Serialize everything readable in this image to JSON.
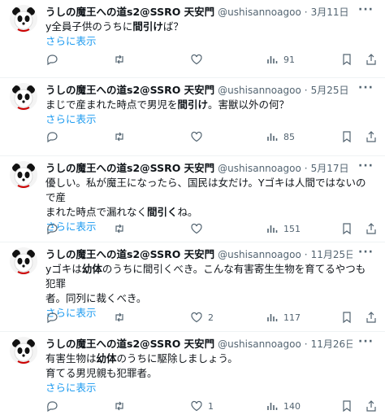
{
  "tweets": [
    {
      "user_name": "うしの魔王への道s2@SSRO 天安門",
      "handle": "@ushisannoagoo",
      "dot": "·",
      "date": "3月11日",
      "line1_pre": "y全員子供のうちに",
      "line1_bold": "間引け",
      "line1_post": "ば？",
      "show_more": "さらに表示",
      "replies": "",
      "retweets": "",
      "likes": "",
      "views": "91"
    },
    {
      "user_name": "うしの魔王への道s2@SSRO 天安門",
      "handle": "@ushisannoagoo",
      "dot": "·",
      "date": "5月25日",
      "line1_pre": "まじで産まれた時点で男児を",
      "line1_bold": "間引け",
      "line1_post": "。害獣以外の何？",
      "show_more": "さらに表示",
      "replies": "",
      "retweets": "",
      "likes": "",
      "views": "85"
    },
    {
      "user_name": "うしの魔王への道s2@SSRO 天安門",
      "handle": "@ushisannoagoo",
      "dot": "·",
      "date": "5月17日",
      "line1": "優しい。私が魔王になったら、国民は女だけ。Yゴキは人間ではないので産",
      "line2_pre": "まれた時点で漏れなく",
      "line2_bold": "間引く",
      "line2_post": "ね。",
      "show_more": "さらに表示",
      "replies": "",
      "retweets": "",
      "likes": "",
      "views": "151"
    },
    {
      "user_name": "うしの魔王への道s2@SSRO 天安門",
      "handle": "@ushisannoagoo",
      "dot": "·",
      "date": "11月25日",
      "line1_pre": "yゴキは",
      "line1_bold": "幼体",
      "line1_post": "のうちに間引くべき。こんな有害寄生生物を育てるやつも犯罪",
      "line2": "者。同列に裁くべき。",
      "show_more": "さらに表示",
      "replies": "",
      "retweets": "",
      "likes": "2",
      "views": "117"
    },
    {
      "user_name": "うしの魔王への道s2@SSRO 天安門",
      "handle": "@ushisannoagoo",
      "dot": "·",
      "date": "11月26日",
      "line1_pre": "有害生物は",
      "line1_bold": "幼体",
      "line1_post": "のうちに駆除しましょう。",
      "line2": "育てる男児親も犯罪者。",
      "show_more": "さらに表示",
      "replies": "",
      "retweets": "",
      "likes": "1",
      "views": "140"
    }
  ],
  "more_glyph": "···",
  "colors": {
    "link": "#1d9bf0",
    "muted": "#536471",
    "text": "#0f1419"
  }
}
